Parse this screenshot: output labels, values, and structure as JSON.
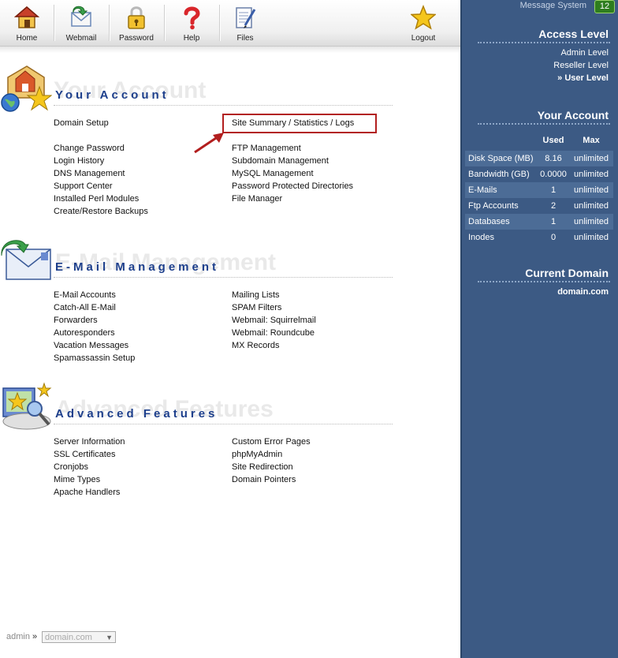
{
  "toolbar": {
    "home": "Home",
    "webmail": "Webmail",
    "password": "Password",
    "help": "Help",
    "files": "Files",
    "logout": "Logout"
  },
  "sections": {
    "account": {
      "title": "Your Account",
      "ghost": "Your Account",
      "left": [
        "Domain Setup",
        "Change Password",
        "Login History",
        "DNS Management",
        "Support Center",
        "Installed Perl Modules",
        "Create/Restore Backups"
      ],
      "right": [
        "Site Summary / Statistics / Logs",
        "FTP Management",
        "Subdomain Management",
        "MySQL Management",
        "Password Protected Directories",
        "File Manager"
      ]
    },
    "email": {
      "title": "E-Mail Management",
      "ghost": "E-Mail Management",
      "left": [
        "E-Mail Accounts",
        "Catch-All E-Mail",
        "Forwarders",
        "Autoresponders",
        "Vacation Messages",
        "Spamassassin Setup"
      ],
      "right": [
        "Mailing Lists",
        "SPAM Filters",
        "Webmail: Squirrelmail",
        "Webmail: Roundcube",
        "MX Records"
      ]
    },
    "advanced": {
      "title": "Advanced Features",
      "ghost": "Advanced Features",
      "left": [
        "Server Information",
        "SSL Certificates",
        "Cronjobs",
        "Mime Types",
        "Apache Handlers"
      ],
      "right": [
        "Custom Error Pages",
        "phpMyAdmin",
        "Site Redirection",
        "Domain Pointers"
      ]
    }
  },
  "footer": {
    "user": "admin",
    "sep": "»",
    "domain": "domain.com"
  },
  "sidebar": {
    "message_label": "Message System",
    "message_count": "12",
    "access_title": "Access Level",
    "access_levels": [
      "Admin Level",
      "Reseller Level",
      "» User Level"
    ],
    "account_title": "Your Account",
    "col_used": "Used",
    "col_max": "Max",
    "usage": [
      {
        "name": "Disk Space (MB)",
        "used": "8.16",
        "max": "unlimited"
      },
      {
        "name": "Bandwidth (GB)",
        "used": "0.0000",
        "max": "unlimited"
      },
      {
        "name": "E-Mails",
        "used": "1",
        "max": "unlimited"
      },
      {
        "name": "Ftp Accounts",
        "used": "2",
        "max": "unlimited"
      },
      {
        "name": "Databases",
        "used": "1",
        "max": "unlimited"
      },
      {
        "name": "Inodes",
        "used": "0",
        "max": "unlimited"
      }
    ],
    "domain_title": "Current Domain",
    "current_domain": "domain.com"
  },
  "colors": {
    "sidebar_bg": "#3c5a84",
    "section_title": "#1d3f8c",
    "highlight": "#b21e1e"
  }
}
